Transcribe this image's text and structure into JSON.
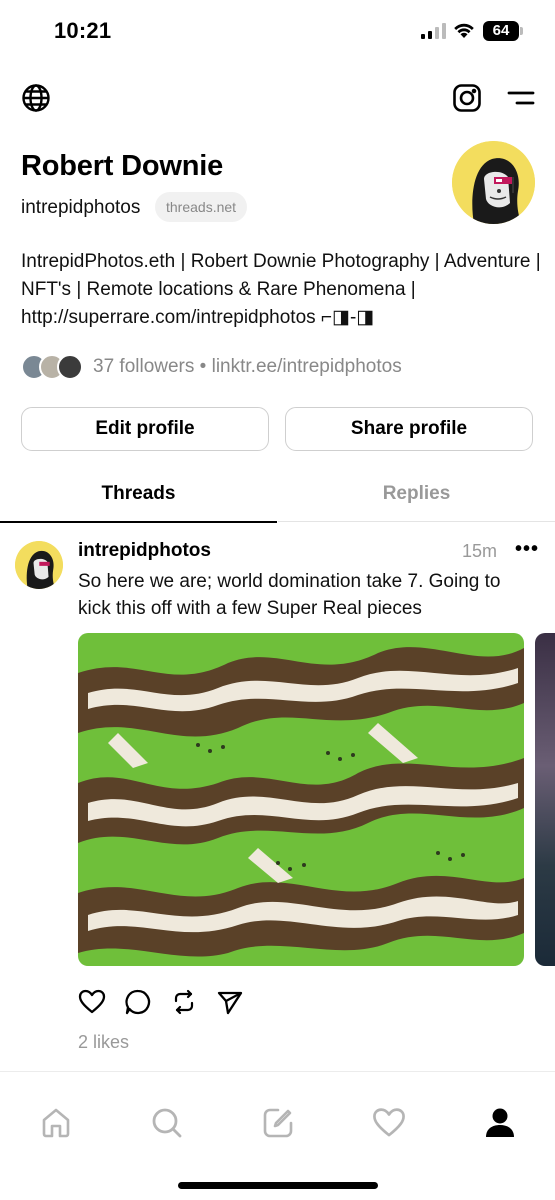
{
  "status_bar": {
    "time": "10:21",
    "battery": "64"
  },
  "profile": {
    "name": "Robert Downie",
    "handle": "intrepidphotos",
    "domain_badge": "threads.net",
    "bio": "IntrepidPhotos.eth | Robert Downie Photography | Adventure | NFT's | Remote locations & Rare Phenomena | http://superrare.com/intrepidphotos ⌐◨-◨",
    "followers_line": "37 followers • linktr.ee/intrepidphotos"
  },
  "buttons": {
    "edit": "Edit profile",
    "share": "Share profile"
  },
  "tabs": [
    {
      "label": "Threads",
      "active": true
    },
    {
      "label": "Replies",
      "active": false
    }
  ],
  "post": {
    "username": "intrepidphotos",
    "time": "15m",
    "more": "•••",
    "text": "So here we are; world domination take 7.  Going to kick this off with a few Super Real pieces",
    "likes": "2 likes"
  },
  "icons": {
    "top_left": "globe-icon",
    "top_right": [
      "instagram-icon",
      "menu-icon"
    ],
    "actions": [
      "heart-icon",
      "comment-icon",
      "repost-icon",
      "send-icon"
    ],
    "nav": [
      "home-icon",
      "search-icon",
      "compose-icon",
      "activity-heart-icon",
      "profile-icon"
    ]
  },
  "colors": {
    "accent_yellow": "#f3dd5e",
    "text_muted": "#999999"
  }
}
